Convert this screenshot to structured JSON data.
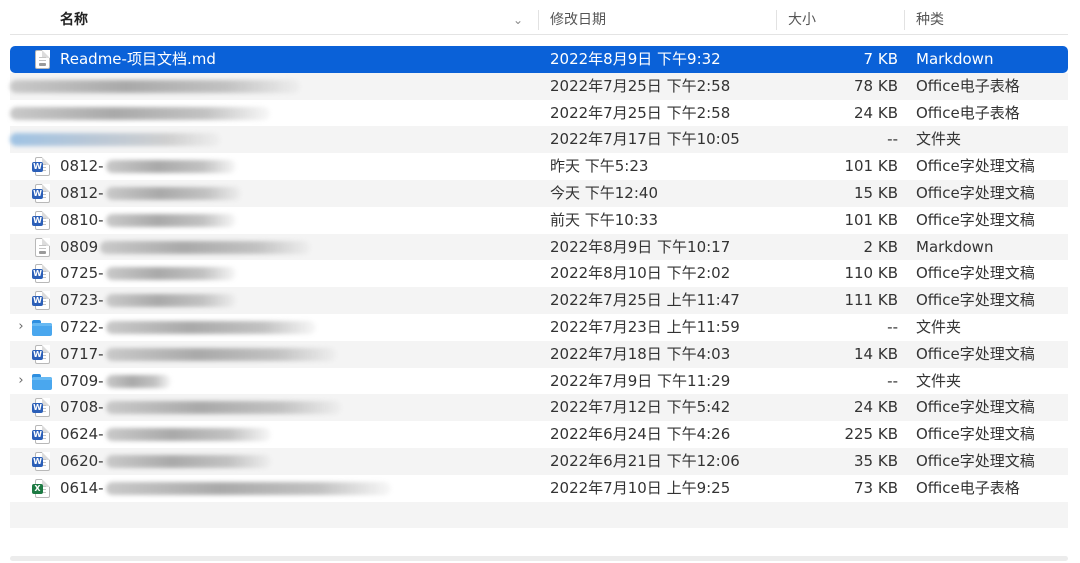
{
  "header": {
    "name": "名称",
    "sort_indicator": "⌄",
    "date": "修改日期",
    "size": "大小",
    "kind": "种类"
  },
  "rows": [
    {
      "name_prefix": "Readme-项目文档.md",
      "blur_w": 0,
      "date": "2022年8月9日 下午9:32",
      "size": "7 KB",
      "kind": "Markdown",
      "icon": "markdown-icon",
      "selected": true
    },
    {
      "name_prefix": "",
      "blur_w": 290,
      "date": "2022年7月25日 下午2:58",
      "size": "78 KB",
      "kind": "Office电子表格",
      "icon": "none"
    },
    {
      "name_prefix": "",
      "blur_w": 260,
      "date": "2022年7月25日 下午2:58",
      "size": "24 KB",
      "kind": "Office电子表格",
      "icon": "none"
    },
    {
      "name_prefix": "",
      "blur_w": 210,
      "date": "2022年7月17日 下午10:05",
      "size": "--",
      "kind": "文件夹",
      "icon": "none",
      "blue_blur": true
    },
    {
      "name_prefix": "0812-",
      "blur_w": 130,
      "date": "昨天 下午5:23",
      "size": "101 KB",
      "kind": "Office字处理文稿",
      "icon": "word-icon"
    },
    {
      "name_prefix": "0812-",
      "blur_w": 135,
      "date": "今天 下午12:40",
      "size": "15 KB",
      "kind": "Office字处理文稿",
      "icon": "word-icon"
    },
    {
      "name_prefix": "0810-",
      "blur_w": 130,
      "date": "前天 下午10:33",
      "size": "101 KB",
      "kind": "Office字处理文稿",
      "icon": "word-icon"
    },
    {
      "name_prefix": "0809",
      "blur_w": 210,
      "date": "2022年8月9日 下午10:17",
      "size": "2 KB",
      "kind": "Markdown",
      "icon": "markdown-icon"
    },
    {
      "name_prefix": "0725-",
      "blur_w": 130,
      "date": "2022年8月10日 下午2:02",
      "size": "110 KB",
      "kind": "Office字处理文稿",
      "icon": "word-icon"
    },
    {
      "name_prefix": "0723-",
      "blur_w": 130,
      "date": "2022年7月25日 上午11:47",
      "size": "111 KB",
      "kind": "Office字处理文稿",
      "icon": "word-icon"
    },
    {
      "name_prefix": "0722-",
      "blur_w": 210,
      "date": "2022年7月23日 上午11:59",
      "size": "--",
      "kind": "文件夹",
      "icon": "folder-icon",
      "folder": true
    },
    {
      "name_prefix": "0717-",
      "blur_w": 230,
      "date": "2022年7月18日 下午4:03",
      "size": "14 KB",
      "kind": "Office字处理文稿",
      "icon": "word-icon"
    },
    {
      "name_prefix": "0709-",
      "blur_w": 65,
      "date": "2022年7月9日 下午11:29",
      "size": "--",
      "kind": "文件夹",
      "icon": "folder-icon",
      "folder": true
    },
    {
      "name_prefix": "0708-",
      "blur_w": 235,
      "date": "2022年7月12日 下午5:42",
      "size": "24 KB",
      "kind": "Office字处理文稿",
      "icon": "word-icon"
    },
    {
      "name_prefix": "0624-",
      "blur_w": 165,
      "date": "2022年6月24日 下午4:26",
      "size": "225 KB",
      "kind": "Office字处理文稿",
      "icon": "word-icon"
    },
    {
      "name_prefix": "0620-",
      "blur_w": 165,
      "date": "2022年6月21日 下午12:06",
      "size": "35 KB",
      "kind": "Office字处理文稿",
      "icon": "word-icon"
    },
    {
      "name_prefix": "0614-",
      "blur_w": 285,
      "date": "2022年7月10日 上午9:25",
      "size": "73 KB",
      "kind": "Office电子表格",
      "icon": "excel-icon"
    }
  ],
  "disclosure_glyph": "›",
  "word_badge": "W",
  "excel_badge": "X"
}
